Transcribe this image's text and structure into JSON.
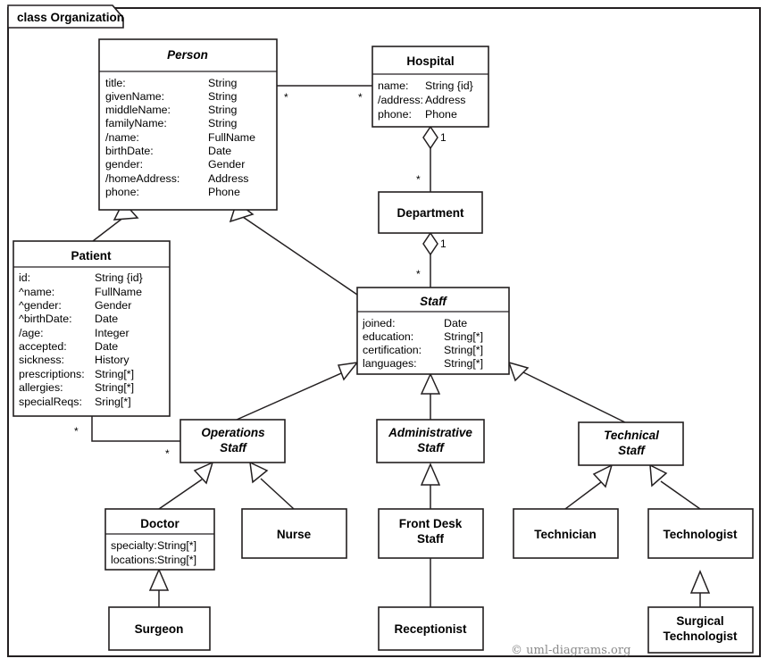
{
  "frame": {
    "label": "class Organization",
    "copyright": "© uml-diagrams.org"
  },
  "classes": {
    "person": {
      "name": "Person",
      "abstract": true,
      "attributes": [
        {
          "name": "title:",
          "type": "String"
        },
        {
          "name": "givenName:",
          "type": "String"
        },
        {
          "name": "middleName:",
          "type": "String"
        },
        {
          "name": "familyName:",
          "type": "String"
        },
        {
          "name": "/name:",
          "type": "FullName"
        },
        {
          "name": "birthDate:",
          "type": "Date"
        },
        {
          "name": "gender:",
          "type": "Gender"
        },
        {
          "name": "/homeAddress:",
          "type": "Address"
        },
        {
          "name": "phone:",
          "type": "Phone"
        }
      ]
    },
    "hospital": {
      "name": "Hospital",
      "abstract": false,
      "attributes": [
        {
          "name": "name:",
          "type": "String {id}"
        },
        {
          "name": "/address:",
          "type": "Address"
        },
        {
          "name": "phone:",
          "type": "Phone"
        }
      ]
    },
    "department": {
      "name": "Department",
      "abstract": false,
      "attributes": []
    },
    "patient": {
      "name": "Patient",
      "abstract": false,
      "attributes": [
        {
          "name": "id:",
          "type": "String {id}"
        },
        {
          "name": "^name:",
          "type": "FullName"
        },
        {
          "name": "^gender:",
          "type": "Gender"
        },
        {
          "name": "^birthDate:",
          "type": "Date"
        },
        {
          "name": "/age:",
          "type": "Integer"
        },
        {
          "name": "accepted:",
          "type": "Date"
        },
        {
          "name": "sickness:",
          "type": "History"
        },
        {
          "name": "prescriptions:",
          "type": "String[*]"
        },
        {
          "name": "allergies:",
          "type": "String[*]"
        },
        {
          "name": "specialReqs:",
          "type": "Sring[*]"
        }
      ]
    },
    "staff": {
      "name": "Staff",
      "abstract": true,
      "attributes": [
        {
          "name": "joined:",
          "type": "Date"
        },
        {
          "name": "education:",
          "type": "String[*]"
        },
        {
          "name": "certification:",
          "type": "String[*]"
        },
        {
          "name": "languages:",
          "type": "String[*]"
        }
      ]
    },
    "operations_staff": {
      "name": "Operations Staff",
      "line1": "Operations",
      "line2": "Staff",
      "abstract": true,
      "attributes": []
    },
    "administrative_staff": {
      "name": "Administrative Staff",
      "line1": "Administrative",
      "line2": "Staff",
      "abstract": true,
      "attributes": []
    },
    "technical_staff": {
      "name": "Technical Staff",
      "line1": "Technical",
      "line2": "Staff",
      "abstract": true,
      "attributes": []
    },
    "doctor": {
      "name": "Doctor",
      "abstract": false,
      "attributes": [
        {
          "name": "specialty:",
          "type": "String[*]"
        },
        {
          "name": "locations:",
          "type": "String[*]"
        }
      ]
    },
    "nurse": {
      "name": "Nurse",
      "abstract": false,
      "attributes": []
    },
    "front_desk_staff": {
      "name": "Front Desk Staff",
      "line1": "Front Desk",
      "line2": "Staff",
      "abstract": false,
      "attributes": []
    },
    "technician": {
      "name": "Technician",
      "abstract": false,
      "attributes": []
    },
    "technologist": {
      "name": "Technologist",
      "abstract": false,
      "attributes": []
    },
    "surgeon": {
      "name": "Surgeon",
      "abstract": false,
      "attributes": []
    },
    "receptionist": {
      "name": "Receptionist",
      "abstract": false,
      "attributes": []
    },
    "surgical_technologist": {
      "name": "Surgical Technologist",
      "line1": "Surgical",
      "line2": "Technologist",
      "abstract": false,
      "attributes": []
    }
  },
  "multiplicities": {
    "person_hospital_source": "*",
    "person_hospital_target": "*",
    "hospital_department_whole": "1",
    "hospital_department_part": "*",
    "department_staff_whole": "1",
    "department_staff_part": "*",
    "patient_operations_source": "*",
    "patient_operations_target": "*"
  },
  "relationships": [
    {
      "kind": "association",
      "from": "Person",
      "to": "Hospital"
    },
    {
      "kind": "aggregation",
      "from": "Hospital",
      "to": "Department"
    },
    {
      "kind": "aggregation",
      "from": "Department",
      "to": "Staff"
    },
    {
      "kind": "generalization",
      "from": "Patient",
      "to": "Person"
    },
    {
      "kind": "generalization",
      "from": "Staff",
      "to": "Person"
    },
    {
      "kind": "association",
      "from": "Patient",
      "to": "Operations Staff"
    },
    {
      "kind": "generalization",
      "from": "Operations Staff",
      "to": "Staff"
    },
    {
      "kind": "generalization",
      "from": "Administrative Staff",
      "to": "Staff"
    },
    {
      "kind": "generalization",
      "from": "Technical Staff",
      "to": "Staff"
    },
    {
      "kind": "generalization",
      "from": "Doctor",
      "to": "Operations Staff"
    },
    {
      "kind": "generalization",
      "from": "Nurse",
      "to": "Operations Staff"
    },
    {
      "kind": "generalization",
      "from": "Front Desk Staff",
      "to": "Administrative Staff"
    },
    {
      "kind": "generalization",
      "from": "Technician",
      "to": "Technical Staff"
    },
    {
      "kind": "generalization",
      "from": "Technologist",
      "to": "Technical Staff"
    },
    {
      "kind": "generalization",
      "from": "Surgeon",
      "to": "Doctor"
    },
    {
      "kind": "generalization",
      "from": "Receptionist",
      "to": "Front Desk Staff"
    },
    {
      "kind": "generalization",
      "from": "Surgical Technologist",
      "to": "Technologist"
    }
  ]
}
